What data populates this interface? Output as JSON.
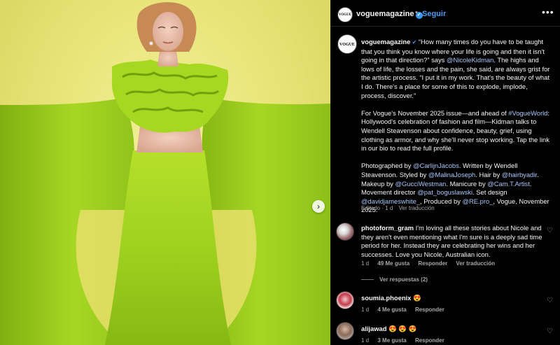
{
  "post": {
    "account": "voguemagazine",
    "follow_label": "Seguir",
    "logo_text": "VOGUE",
    "caption_paragraphs": [
      [
        {
          "t": "voguemagazine",
          "k": "uname"
        },
        {
          "t": " ✔",
          "k": "badge"
        },
        {
          "t": " “How many times do you have to be taught that you think you know where your life is going and then it isn't going in that direction?” says ",
          "k": "text"
        },
        {
          "t": "@NicoleKidman",
          "k": "link"
        },
        {
          "t": ". The highs and lows of life, the losses and the pain, she said, are always grist for the artistic process. “I put it in my work. That's the beauty of what I do. There's a place for some of this to explode, implode, process, discover.”",
          "k": "text"
        }
      ],
      [
        {
          "t": "For Vogue's November 2025 issue—and ahead of ",
          "k": "text"
        },
        {
          "t": "#VogueWorld",
          "k": "link"
        },
        {
          "t": ": Hollywood's celebration of fashion and film—Kidman talks to Wendell Steavenson about confidence, beauty, grief, using clothing as armor, and why she'll never stop working. Tap the link in our bio to read the full profile.",
          "k": "text"
        }
      ],
      [
        {
          "t": "Photographed by ",
          "k": "text"
        },
        {
          "t": "@CarlijnJacobs",
          "k": "link"
        },
        {
          "t": ". Written by Wendell Steavenson. Styled by ",
          "k": "text"
        },
        {
          "t": "@MalinaJoseph",
          "k": "link"
        },
        {
          "t": ". Hair by ",
          "k": "text"
        },
        {
          "t": "@hairbyadir",
          "k": "link"
        },
        {
          "t": ". Makeup by ",
          "k": "text"
        },
        {
          "t": "@GucciWestman",
          "k": "link"
        },
        {
          "t": ". Manicure by ",
          "k": "text"
        },
        {
          "t": "@Cam.T.Artist",
          "k": "link"
        },
        {
          "t": ". Movement director ",
          "k": "text"
        },
        {
          "t": "@pat_boguslawski",
          "k": "link"
        },
        {
          "t": ". Set design ",
          "k": "text"
        },
        {
          "t": "@davidjameswhite_",
          "k": "link"
        },
        {
          "t": ", Produced by ",
          "k": "text"
        },
        {
          "t": "@RE.pro_",
          "k": "link"
        },
        {
          "t": ", Vogue, November 2025.",
          "k": "text"
        }
      ]
    ],
    "caption_meta": {
      "edited": "Editado · 1 d",
      "translate": "Ver traducción"
    }
  },
  "comments": [
    {
      "user": "photoform_gram",
      "text": " I'm loving all these stories about Nicole and they aren't even mentioning what I'm sure is a deeply sad time period for her. Instead they are celebrating her wins and her successes. Love you Nicole, Australian icon.",
      "meta": {
        "age": "1 d",
        "likes": "49 Me gusta",
        "reply": "Responder",
        "translate": "Ver traducción"
      },
      "replies": "Ver respuestas (2)"
    },
    {
      "user": "soumia.phoenix",
      "text": " 😍",
      "meta": {
        "age": "1 d",
        "likes": "4 Me gusta",
        "reply": "Responder"
      }
    },
    {
      "user": "alijawad",
      "text": " 😍 😍 😍",
      "meta": {
        "age": "1 d",
        "likes": "3 Me gusta",
        "reply": "Responder"
      }
    }
  ],
  "colors": {
    "link": "#a8c7fa",
    "follow": "#4f9cf9",
    "background": "#000000",
    "photo_bg": "#e9e57a",
    "dress": "#9fd11f"
  },
  "icons": [
    "verified-badge-icon",
    "more-options-icon",
    "heart-icon",
    "chevron-right-icon"
  ]
}
